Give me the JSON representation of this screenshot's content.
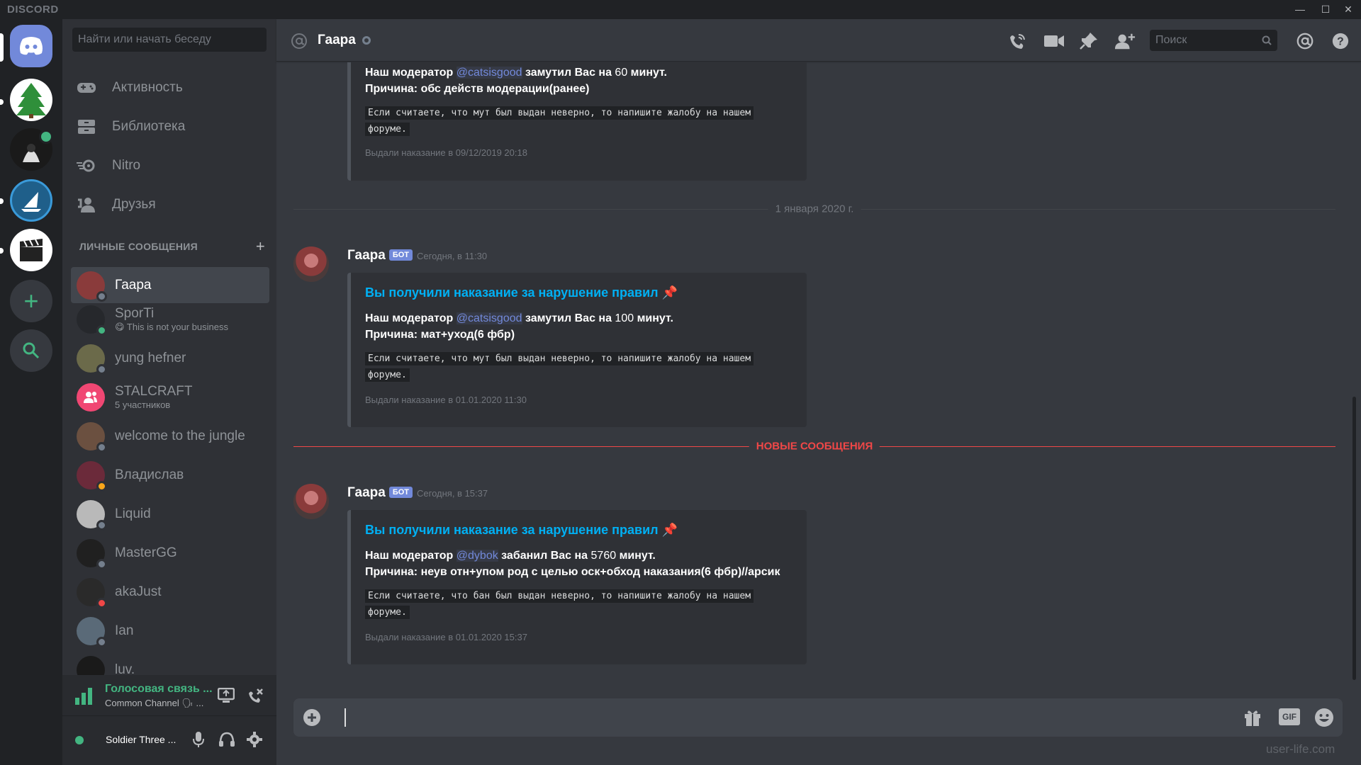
{
  "app": {
    "brand": "DISCORD"
  },
  "window_controls": [
    "—",
    "☐",
    "✕"
  ],
  "sidebar": {
    "search_placeholder": "Найти или начать беседу",
    "nav": [
      {
        "label": "Активность",
        "icon": "gamepad-icon"
      },
      {
        "label": "Библиотека",
        "icon": "library-icon"
      },
      {
        "label": "Nitro",
        "icon": "nitro-icon"
      },
      {
        "label": "Друзья",
        "icon": "friends-icon"
      }
    ],
    "dm_header": "ЛИЧНЫЕ СООБЩЕНИЯ",
    "dms": [
      {
        "name": "Гаара",
        "sub": "",
        "status": "offline",
        "color": "#8a3b3b"
      },
      {
        "name": "SporTi",
        "sub": "😋 This is not your business",
        "status": "online",
        "color": "#26282c"
      },
      {
        "name": "yung hefner",
        "sub": "",
        "status": "offline",
        "color": "#6b6a4a"
      },
      {
        "name": "STALCRAFT",
        "sub": "5 участников",
        "status": "",
        "color": "#f04773"
      },
      {
        "name": "welcome to the jungle",
        "sub": "",
        "status": "offline",
        "color": "#6b5040"
      },
      {
        "name": "Владислав",
        "sub": "",
        "status": "idle",
        "color": "#6b2a3a"
      },
      {
        "name": "Liquid",
        "sub": "",
        "status": "offline",
        "color": "#b9b9b9"
      },
      {
        "name": "MasterGG",
        "sub": "",
        "status": "offline",
        "color": "#202020"
      },
      {
        "name": "akaJust",
        "sub": "",
        "status": "dnd",
        "color": "#2a2a2a"
      },
      {
        "name": "Ian",
        "sub": "",
        "status": "offline",
        "color": "#5a6a78"
      },
      {
        "name": "luv.",
        "sub": "",
        "status": "offline",
        "color": "#1a1a1a"
      }
    ]
  },
  "voice": {
    "title": "Голосовая связь ...",
    "channel": "Common Channel 🗣 ..."
  },
  "user": {
    "name": "Soldier Three ..."
  },
  "chat": {
    "title": "Гаара",
    "search_placeholder": "Поиск",
    "date_divider": "1 января 2020 г.",
    "new_divider": "НОВЫЕ СООБЩЕНИЯ",
    "bot_tag": "БОТ",
    "top_embed": {
      "line1_pre": "Наш модератор",
      "mention": "@catsisgood",
      "line1_mid": "замутил Вас на",
      "num": "60",
      "line1_post": "минут.",
      "line2": "Причина: обс действ модерации(ранее)",
      "code1": "Если считаете, что мут был выдан неверно, то напишите жалобу на нашем",
      "code2": "форуме.",
      "foot": "Выдали наказание в 09/12/2019 20:18"
    },
    "messages": [
      {
        "author": "Гаара",
        "time": "Сегодня, в 11:30",
        "title": "Вы получили наказание за нарушение правил 📌",
        "line1_pre": "Наш модератор",
        "mention": "@catsisgood",
        "line1_mid": "замутил Вас на",
        "num": "100",
        "line1_post": "минут.",
        "line2": "Причина: мат+уход(6 фбр)",
        "code1": "Если считаете, что мут был выдан неверно, то напишите жалобу на нашем",
        "code2": "форуме.",
        "foot": "Выдали наказание в 01.01.2020 11:30"
      },
      {
        "author": "Гаара",
        "time": "Сегодня, в 15:37",
        "title": "Вы получили наказание за нарушение правил 📌",
        "line1_pre": "Наш модератор",
        "mention": "@dybok",
        "line1_mid": "забанил Вас на",
        "num": "5760",
        "line1_post": "минут.",
        "line2": "Причина: неув отн+упом род с целью оск+обход наказания(6 фбр)//арсик",
        "code1": "Если считаете, что бан был выдан неверно, то напишите жалобу на нашем",
        "code2": "форуме.",
        "foot": "Выдали наказание в 01.01.2020 15:37"
      }
    ]
  },
  "composer": {
    "gif_label": "GIF"
  },
  "watermark": "user-life.com",
  "colors": {
    "accent": "#7289da",
    "link": "#00b0f4",
    "new": "#f04747",
    "online": "#43b581",
    "idle": "#faa61a",
    "dnd": "#f04747",
    "offline": "#747f8d"
  }
}
